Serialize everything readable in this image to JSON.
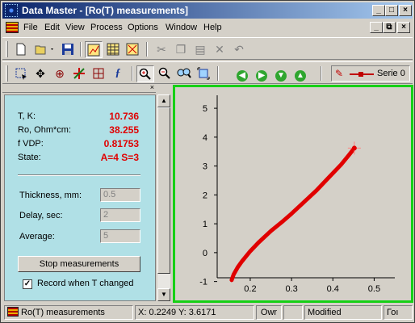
{
  "window": {
    "title": "Data Master - [Ro(T) measurements]",
    "caption_buttons": [
      "_",
      "□",
      "×"
    ],
    "mdi_buttons": [
      "_",
      "⧉",
      "×"
    ]
  },
  "menu": [
    "File",
    "Edit",
    "View",
    "Process",
    "Options",
    "Window",
    "Help"
  ],
  "toolbar1": {
    "buttons": [
      "new-icon",
      "open-icon",
      "save-icon",
      "chart-view-icon",
      "grid-view-icon",
      "chart-edit-icon",
      "cut-icon",
      "copy-icon",
      "paste-icon",
      "delete-icon",
      "undo-icon"
    ]
  },
  "toolbar2": {
    "buttons": [
      "select-icon",
      "move-icon",
      "target-icon",
      "cross-icon",
      "pointer-icon",
      "function-icon",
      "zoom-in-icon",
      "zoom-out-icon",
      "zoom-fit-icon",
      "autoscale-icon",
      "nav-left-icon",
      "nav-right-icon",
      "nav-down-icon",
      "nav-up-icon"
    ],
    "serie_label": "Serie 0"
  },
  "panel": {
    "readouts": [
      {
        "label": "T, K:",
        "value": "10.736"
      },
      {
        "label": "Ro, Ohm*cm:",
        "value": "38.255"
      },
      {
        "label": "f VDP:",
        "value": "0.81753"
      },
      {
        "label": "State:",
        "value": "A=4  S=3"
      }
    ],
    "fields": [
      {
        "label": "Thickness, mm:",
        "value": "0.5"
      },
      {
        "label": "Delay, sec:",
        "value": "2"
      },
      {
        "label": "Average:",
        "value": "5"
      }
    ],
    "stop_button": "Stop measurements",
    "record_checkbox": {
      "label": "Record when T changed",
      "checked": true
    }
  },
  "chart_data": {
    "type": "line",
    "xlabel": "",
    "ylabel": "",
    "xlim": [
      0.12,
      0.55
    ],
    "ylim": [
      -1.15,
      5.45
    ],
    "xticks": [
      "0.2",
      "0.3",
      "0.4",
      "0.5"
    ],
    "xtick_values": [
      0.2,
      0.3,
      0.4,
      0.5
    ],
    "yticks": [
      "-1",
      "0",
      "1",
      "2",
      "3",
      "4",
      "5"
    ],
    "ytick_values": [
      -1,
      0,
      1,
      2,
      3,
      4,
      5
    ],
    "grid": false,
    "series": [
      {
        "color": "#e00000",
        "x": [
          0.155,
          0.16,
          0.17,
          0.18,
          0.2,
          0.22,
          0.25,
          0.28,
          0.3,
          0.33,
          0.36,
          0.39,
          0.42,
          0.44,
          0.452
        ],
        "y": [
          -0.95,
          -0.75,
          -0.5,
          -0.3,
          0.05,
          0.35,
          0.75,
          1.1,
          1.35,
          1.75,
          2.15,
          2.6,
          3.05,
          3.4,
          3.62
        ]
      }
    ],
    "cursor": {
      "x": 0.452,
      "y": 3.62
    }
  },
  "status": {
    "doc": "Ro(T) measurements",
    "coords": "X: 0.2249 Y: 3.6171",
    "mode": "Owr",
    "modified": "Modified",
    "extra": "Гоı"
  }
}
